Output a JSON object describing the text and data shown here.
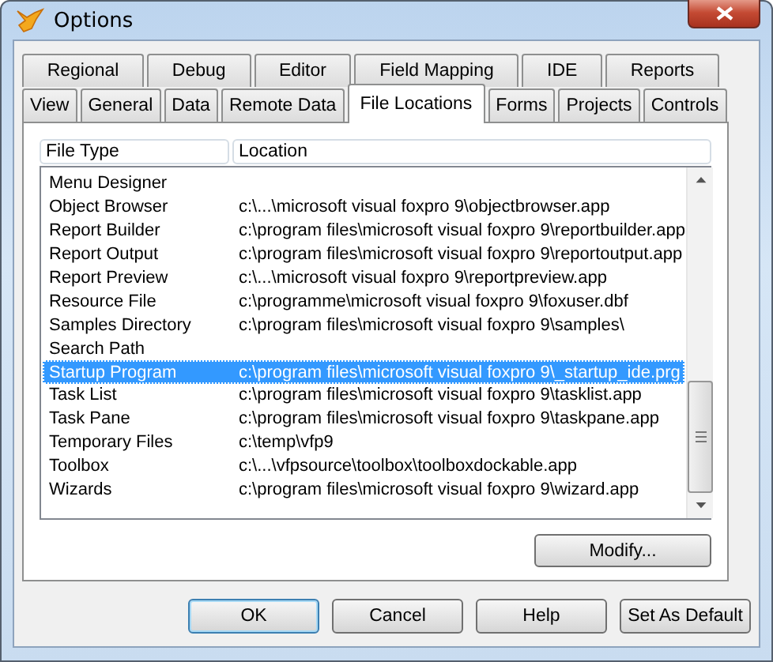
{
  "window": {
    "title": "Options"
  },
  "tab_rows": [
    [
      {
        "label": "Regional",
        "selected": false
      },
      {
        "label": "Debug",
        "selected": false
      },
      {
        "label": "Editor",
        "selected": false
      },
      {
        "label": "Field Mapping",
        "selected": false
      },
      {
        "label": "IDE",
        "selected": false
      },
      {
        "label": "Reports",
        "selected": false
      }
    ],
    [
      {
        "label": "View",
        "selected": false
      },
      {
        "label": "General",
        "selected": false
      },
      {
        "label": "Data",
        "selected": false
      },
      {
        "label": "Remote Data",
        "selected": false
      },
      {
        "label": "File Locations",
        "selected": true
      },
      {
        "label": "Forms",
        "selected": false
      },
      {
        "label": "Projects",
        "selected": false
      },
      {
        "label": "Controls",
        "selected": false
      }
    ]
  ],
  "table": {
    "columns": [
      "File Type",
      "Location"
    ],
    "rows": [
      {
        "file_type": "Menu Designer",
        "location": "",
        "selected": false
      },
      {
        "file_type": "Object Browser",
        "location": "c:\\...\\microsoft visual foxpro 9\\objectbrowser.app",
        "selected": false
      },
      {
        "file_type": "Report Builder",
        "location": "c:\\program files\\microsoft visual foxpro 9\\reportbuilder.app",
        "selected": false
      },
      {
        "file_type": "Report Output",
        "location": "c:\\program files\\microsoft visual foxpro 9\\reportoutput.app",
        "selected": false
      },
      {
        "file_type": "Report Preview",
        "location": "c:\\...\\microsoft visual foxpro 9\\reportpreview.app",
        "selected": false
      },
      {
        "file_type": "Resource File",
        "location": "c:\\programme\\microsoft visual foxpro 9\\foxuser.dbf",
        "selected": false
      },
      {
        "file_type": "Samples Directory",
        "location": "c:\\program files\\microsoft visual foxpro 9\\samples\\",
        "selected": false
      },
      {
        "file_type": "Search Path",
        "location": "",
        "selected": false
      },
      {
        "file_type": "Startup Program",
        "location": "c:\\program files\\microsoft visual foxpro 9\\_startup_ide.prg",
        "selected": true
      },
      {
        "file_type": "Task List",
        "location": "c:\\program files\\microsoft visual foxpro 9\\tasklist.app",
        "selected": false
      },
      {
        "file_type": "Task Pane",
        "location": "c:\\program files\\microsoft visual foxpro 9\\taskpane.app",
        "selected": false
      },
      {
        "file_type": "Temporary Files",
        "location": "c:\\temp\\vfp9",
        "selected": false
      },
      {
        "file_type": "Toolbox",
        "location": "c:\\...\\vfpsource\\toolbox\\toolboxdockable.app",
        "selected": false
      },
      {
        "file_type": "Wizards",
        "location": "c:\\program files\\microsoft visual foxpro 9\\wizard.app",
        "selected": false
      }
    ]
  },
  "modify_button": "Modify...",
  "buttons": [
    {
      "label": "OK",
      "default": true
    },
    {
      "label": "Cancel",
      "default": false
    },
    {
      "label": "Help",
      "default": false
    },
    {
      "label": "Set As Default",
      "default": false
    }
  ]
}
